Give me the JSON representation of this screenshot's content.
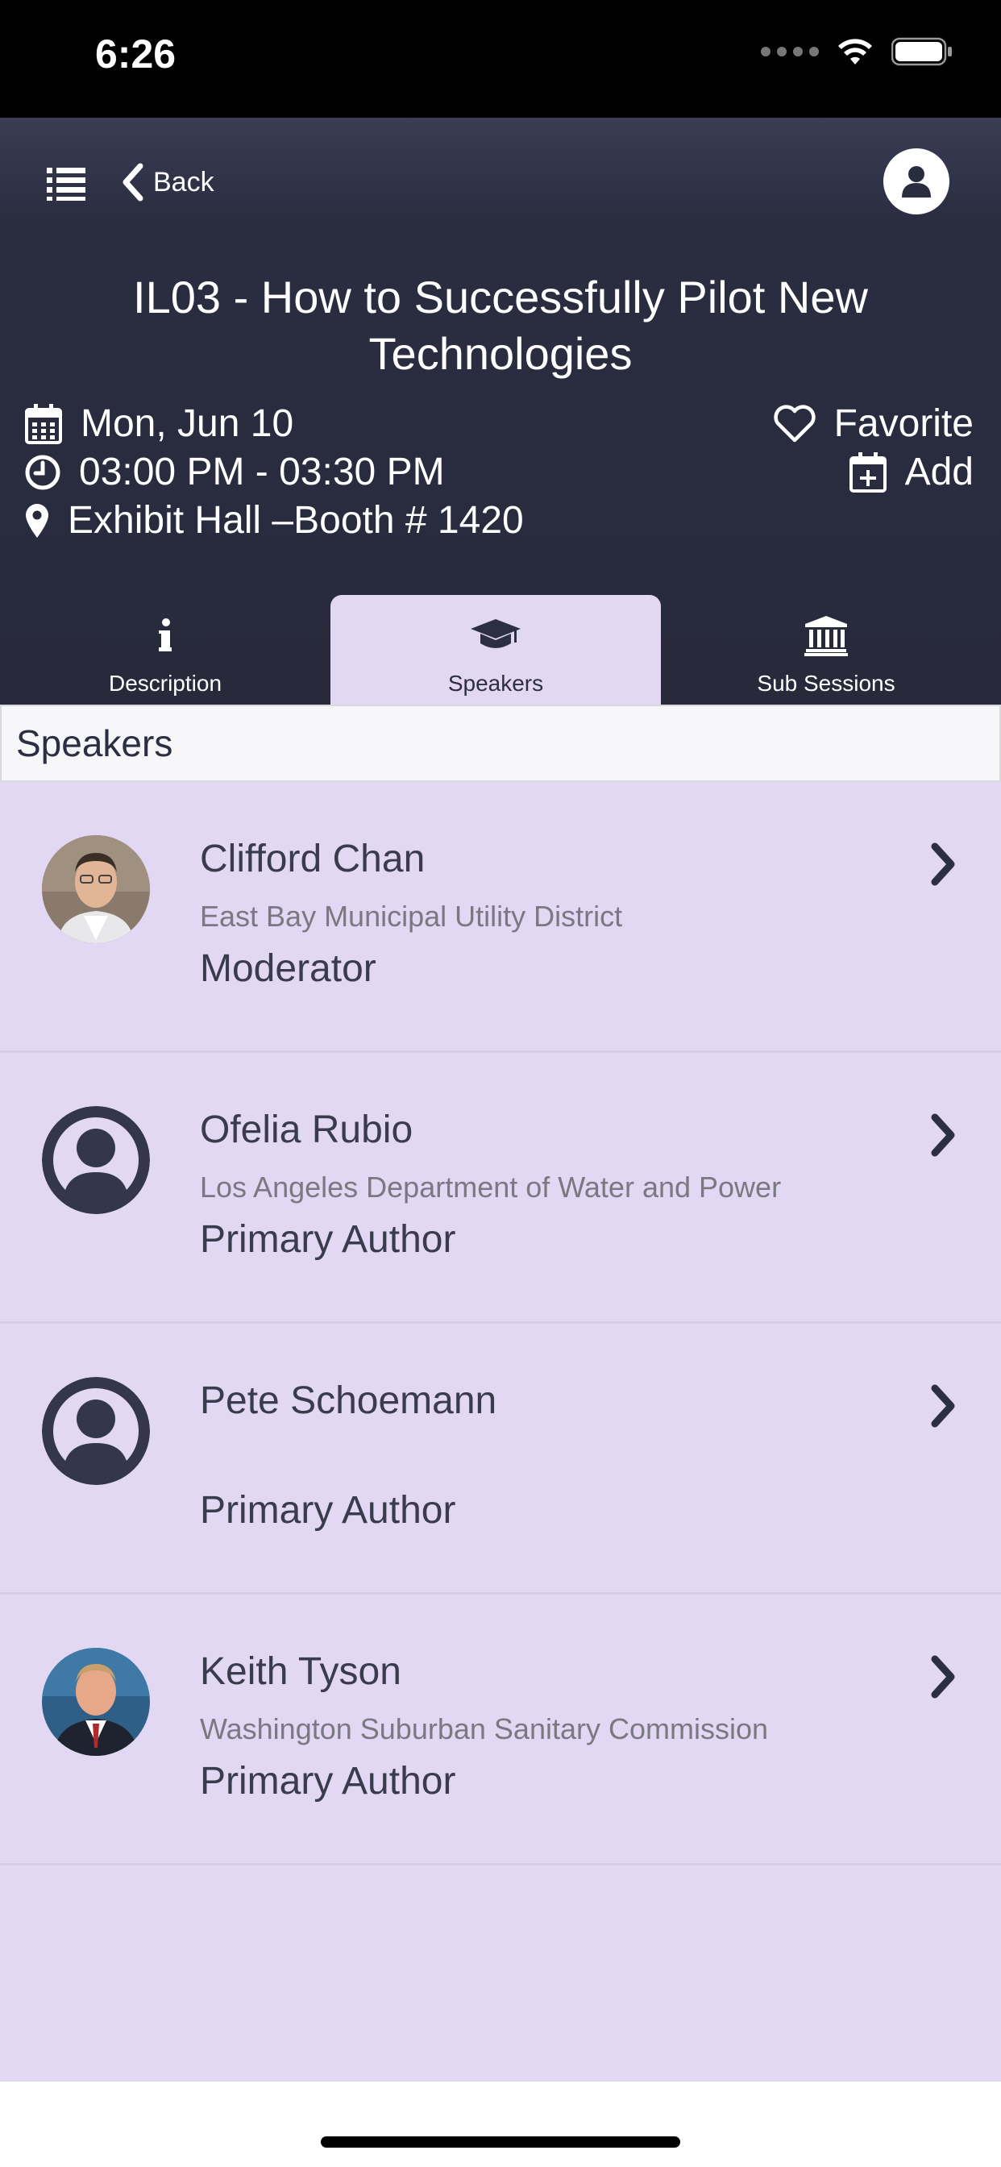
{
  "status_bar": {
    "time": "6:26"
  },
  "nav": {
    "back_label": "Back",
    "menu_icon": "list-icon",
    "profile_icon": "user-icon"
  },
  "session": {
    "title": "IL03 - How to Successfully Pilot New Technologies",
    "date": "Mon, Jun 10",
    "time_range": "03:00 PM - 03:30 PM",
    "location": "Exhibit Hall –Booth # 1420",
    "favorite_label": "Favorite",
    "add_label": "Add"
  },
  "tabs": [
    {
      "label": "Description",
      "icon": "info-icon",
      "active": false
    },
    {
      "label": "Speakers",
      "icon": "graduation-cap-icon",
      "active": true
    },
    {
      "label": "Sub Sessions",
      "icon": "institution-icon",
      "active": false
    }
  ],
  "section_title": "Speakers",
  "speakers": [
    {
      "name": "Clifford Chan",
      "organization": "East Bay Municipal Utility District",
      "role": "Moderator",
      "photo": "photo"
    },
    {
      "name": "Ofelia Rubio",
      "organization": "Los Angeles Department of Water and Power",
      "role": "Primary Author",
      "photo": "placeholder"
    },
    {
      "name": "Pete Schoemann",
      "organization": "",
      "role": "Primary Author",
      "photo": "placeholder"
    },
    {
      "name": "Keith Tyson",
      "organization": "Washington Suburban Sanitary Commission",
      "role": "Primary Author",
      "photo": "photo"
    }
  ],
  "colors": {
    "header_bg": "#282a3c",
    "list_bg": "#e2d8f4",
    "active_tab_bg": "#e2d8f4",
    "text_dark": "#3a3c4e"
  }
}
